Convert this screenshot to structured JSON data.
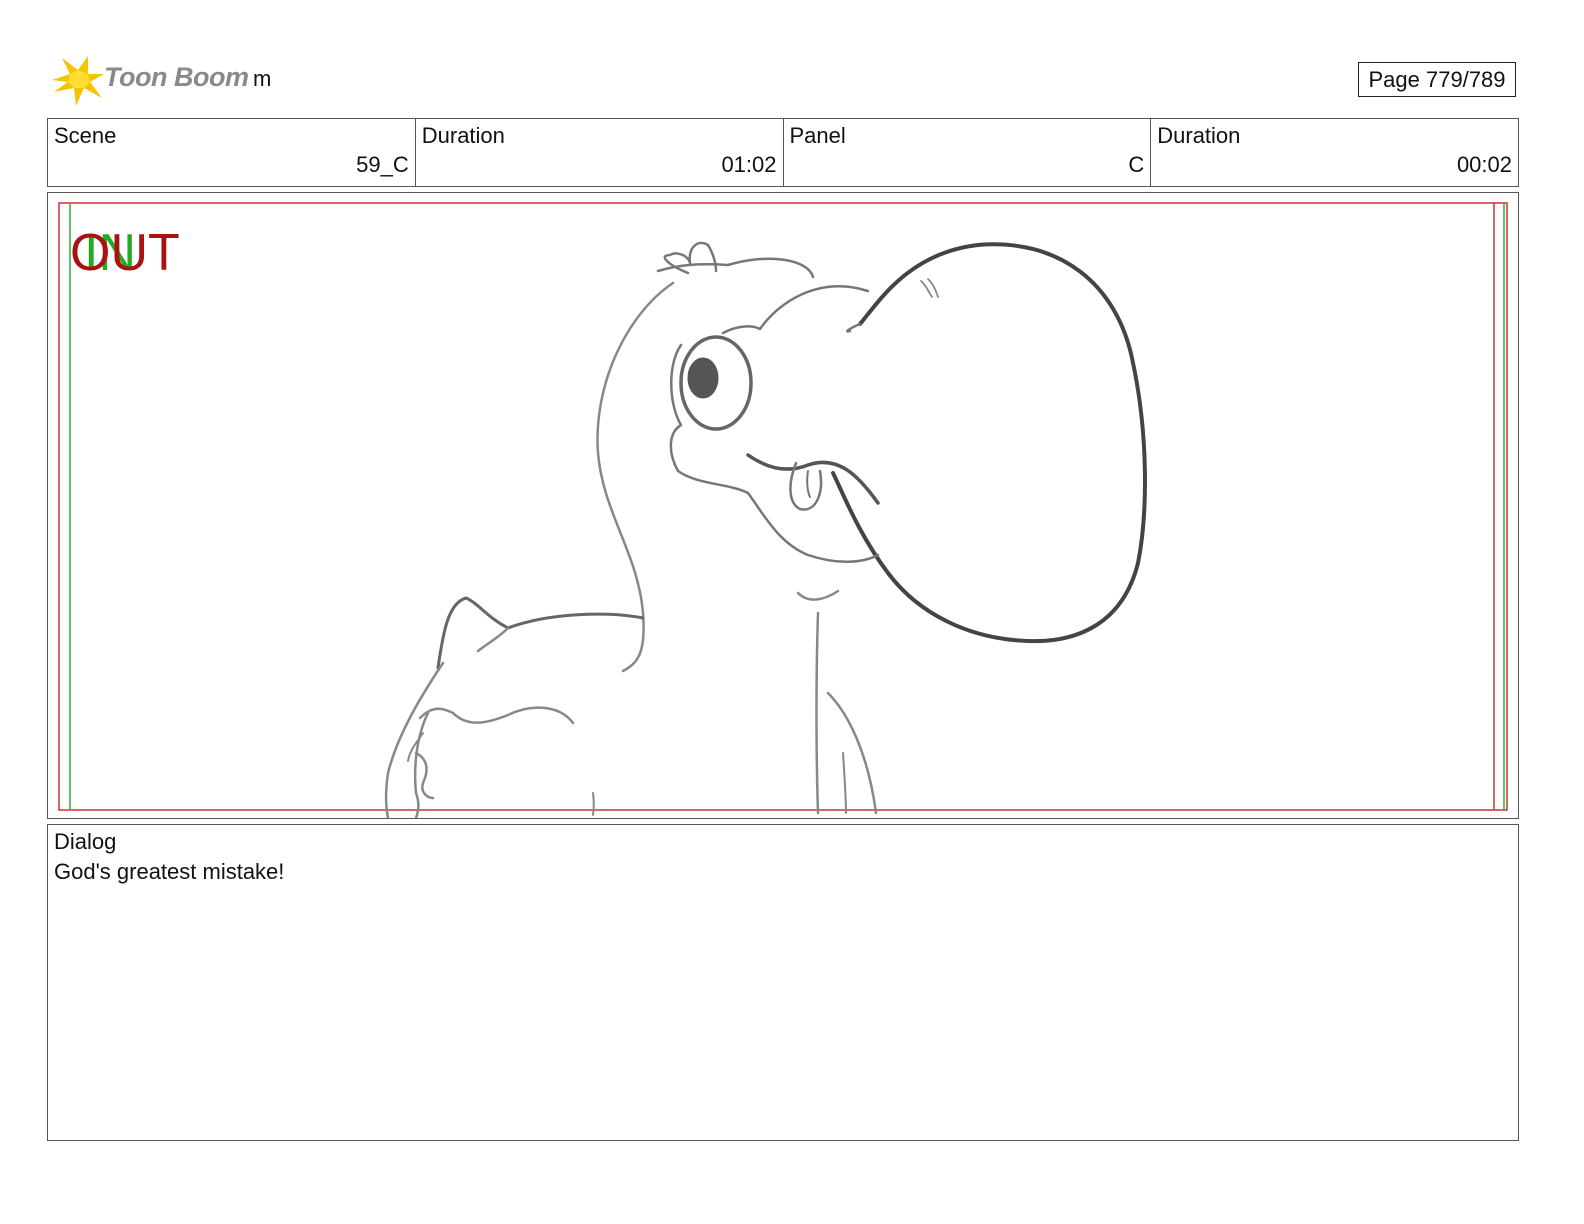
{
  "header": {
    "logo_text": "Toon Boom",
    "project_name": "m",
    "page_label": "Page 779/789"
  },
  "info": {
    "scene_label": "Scene",
    "scene_value": "59_C",
    "scene_duration_label": "Duration",
    "scene_duration_value": "01:02",
    "panel_label": "Panel",
    "panel_value": "C",
    "panel_duration_label": "Duration",
    "panel_duration_value": "00:02"
  },
  "panel": {
    "in_marker": "IN",
    "out_marker": "OUT",
    "in_color": "#22aa22",
    "out_color": "#aa1111",
    "safe_frame_color": "#cc3333",
    "guide_color": "#33aa33"
  },
  "dialog": {
    "label": "Dialog",
    "text": "God's greatest mistake!"
  }
}
